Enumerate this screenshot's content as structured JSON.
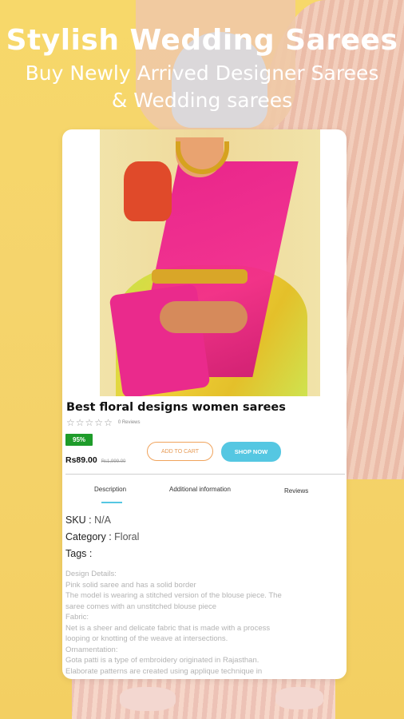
{
  "headline": {
    "title": "Stylish Wedding Sarees",
    "subtitle_line1": "Buy Newly Arrived Designer Sarees",
    "subtitle_line2": "& Wedding sarees"
  },
  "product": {
    "title": "Best floral designs women sarees",
    "rating_stars": 0,
    "reviews_label": "0 Reviews",
    "discount_badge": "95%",
    "price_current": "Rs89.00",
    "price_original": "Rs1,999.00",
    "add_to_cart_label": "ADD TO CART",
    "shop_now_label": "SHOP NOW"
  },
  "tabs": {
    "description": "Description",
    "additional": "Additional information",
    "reviews": "Reviews",
    "active": "description"
  },
  "meta": {
    "sku_label": "SKU :",
    "sku_value": "N/A",
    "category_label": "Category :",
    "category_value": "Floral",
    "tags_label": "Tags :"
  },
  "description_lines": [
    "Design Details:",
    "Pink solid saree and has a solid border",
    "The model is wearing a stitched version of the blouse piece. The",
    "saree comes with an unstitched blouse piece",
    "Fabric:",
    "Net is a sheer and delicate fabric that is made with a process",
    "looping or knotting of the weave at intersections.",
    "Ornamentation:",
    "Gota patti is a type of embroidery originated in Rajasthan.",
    "Elaborate patterns are created using applique technique in"
  ],
  "colors": {
    "background": "#f5d46c",
    "badge": "#1e9c2a",
    "accent_blue": "#55c7e2",
    "accent_orange": "#f0a35c"
  }
}
